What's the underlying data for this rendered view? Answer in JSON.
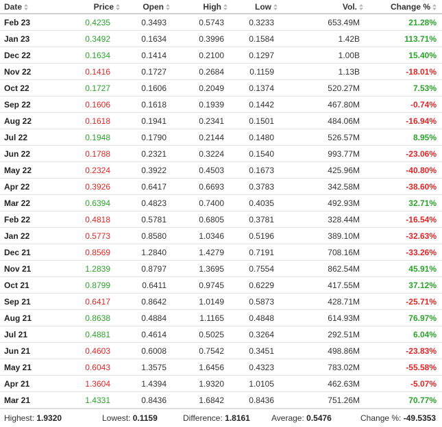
{
  "columns": [
    {
      "key": "date",
      "label": "Date"
    },
    {
      "key": "price",
      "label": "Price"
    },
    {
      "key": "open",
      "label": "Open"
    },
    {
      "key": "high",
      "label": "High"
    },
    {
      "key": "low",
      "label": "Low"
    },
    {
      "key": "vol",
      "label": "Vol."
    },
    {
      "key": "change",
      "label": "Change %"
    }
  ],
  "rows": [
    {
      "date": "Feb 23",
      "price": "0.4235",
      "open": "0.3493",
      "high": "0.5743",
      "low": "0.3233",
      "vol": "653.49M",
      "change": "21.28%",
      "dir": "up"
    },
    {
      "date": "Jan 23",
      "price": "0.3492",
      "open": "0.1634",
      "high": "0.3996",
      "low": "0.1584",
      "vol": "1.42B",
      "change": "113.71%",
      "dir": "up"
    },
    {
      "date": "Dec 22",
      "price": "0.1634",
      "open": "0.1414",
      "high": "0.2100",
      "low": "0.1297",
      "vol": "1.00B",
      "change": "15.40%",
      "dir": "up"
    },
    {
      "date": "Nov 22",
      "price": "0.1416",
      "open": "0.1727",
      "high": "0.2684",
      "low": "0.1159",
      "vol": "1.13B",
      "change": "-18.01%",
      "dir": "down"
    },
    {
      "date": "Oct 22",
      "price": "0.1727",
      "open": "0.1606",
      "high": "0.2049",
      "low": "0.1374",
      "vol": "520.27M",
      "change": "7.53%",
      "dir": "up"
    },
    {
      "date": "Sep 22",
      "price": "0.1606",
      "open": "0.1618",
      "high": "0.1939",
      "low": "0.1442",
      "vol": "467.80M",
      "change": "-0.74%",
      "dir": "down"
    },
    {
      "date": "Aug 22",
      "price": "0.1618",
      "open": "0.1941",
      "high": "0.2341",
      "low": "0.1501",
      "vol": "484.06M",
      "change": "-16.94%",
      "dir": "down"
    },
    {
      "date": "Jul 22",
      "price": "0.1948",
      "open": "0.1790",
      "high": "0.2144",
      "low": "0.1480",
      "vol": "526.57M",
      "change": "8.95%",
      "dir": "up"
    },
    {
      "date": "Jun 22",
      "price": "0.1788",
      "open": "0.2321",
      "high": "0.3224",
      "low": "0.1540",
      "vol": "993.77M",
      "change": "-23.06%",
      "dir": "down"
    },
    {
      "date": "May 22",
      "price": "0.2324",
      "open": "0.3922",
      "high": "0.4503",
      "low": "0.1673",
      "vol": "425.96M",
      "change": "-40.80%",
      "dir": "down"
    },
    {
      "date": "Apr 22",
      "price": "0.3926",
      "open": "0.6417",
      "high": "0.6693",
      "low": "0.3783",
      "vol": "342.58M",
      "change": "-38.60%",
      "dir": "down"
    },
    {
      "date": "Mar 22",
      "price": "0.6394",
      "open": "0.4823",
      "high": "0.7400",
      "low": "0.4035",
      "vol": "492.93M",
      "change": "32.71%",
      "dir": "up"
    },
    {
      "date": "Feb 22",
      "price": "0.4818",
      "open": "0.5781",
      "high": "0.6805",
      "low": "0.3781",
      "vol": "328.44M",
      "change": "-16.54%",
      "dir": "down"
    },
    {
      "date": "Jan 22",
      "price": "0.5773",
      "open": "0.8580",
      "high": "1.0346",
      "low": "0.5196",
      "vol": "389.10M",
      "change": "-32.63%",
      "dir": "down"
    },
    {
      "date": "Dec 21",
      "price": "0.8569",
      "open": "1.2840",
      "high": "1.4279",
      "low": "0.7191",
      "vol": "708.16M",
      "change": "-33.26%",
      "dir": "down"
    },
    {
      "date": "Nov 21",
      "price": "1.2839",
      "open": "0.8797",
      "high": "1.3695",
      "low": "0.7554",
      "vol": "862.54M",
      "change": "45.91%",
      "dir": "up"
    },
    {
      "date": "Oct 21",
      "price": "0.8799",
      "open": "0.6411",
      "high": "0.9745",
      "low": "0.6229",
      "vol": "417.55M",
      "change": "37.12%",
      "dir": "up"
    },
    {
      "date": "Sep 21",
      "price": "0.6417",
      "open": "0.8642",
      "high": "1.0149",
      "low": "0.5873",
      "vol": "428.71M",
      "change": "-25.71%",
      "dir": "down"
    },
    {
      "date": "Aug 21",
      "price": "0.8638",
      "open": "0.4884",
      "high": "1.1165",
      "low": "0.4848",
      "vol": "614.93M",
      "change": "76.97%",
      "dir": "up"
    },
    {
      "date": "Jul 21",
      "price": "0.4881",
      "open": "0.4614",
      "high": "0.5025",
      "low": "0.3264",
      "vol": "292.51M",
      "change": "6.04%",
      "dir": "up"
    },
    {
      "date": "Jun 21",
      "price": "0.4603",
      "open": "0.6008",
      "high": "0.7542",
      "low": "0.3451",
      "vol": "498.86M",
      "change": "-23.83%",
      "dir": "down"
    },
    {
      "date": "May 21",
      "price": "0.6043",
      "open": "1.3575",
      "high": "1.6456",
      "low": "0.4323",
      "vol": "783.02M",
      "change": "-55.58%",
      "dir": "down"
    },
    {
      "date": "Apr 21",
      "price": "1.3604",
      "open": "1.4394",
      "high": "1.9320",
      "low": "1.0105",
      "vol": "462.63M",
      "change": "-5.07%",
      "dir": "down"
    },
    {
      "date": "Mar 21",
      "price": "1.4331",
      "open": "0.8436",
      "high": "1.6842",
      "low": "0.8436",
      "vol": "751.26M",
      "change": "70.77%",
      "dir": "up"
    }
  ],
  "summary": {
    "highest_label": "Highest:",
    "highest_value": "1.9320",
    "lowest_label": "Lowest:",
    "lowest_value": "0.1159",
    "difference_label": "Difference:",
    "difference_value": "1.8161",
    "average_label": "Average:",
    "average_value": "0.5476",
    "change_label": "Change %:",
    "change_value": "-49.5353"
  },
  "colors": {
    "up": "#2aa32a",
    "down": "#e02525",
    "header_border": "#d0d0d0",
    "row_border": "#e2e2e2"
  },
  "icons": {
    "sort": "sort-arrows-icon"
  }
}
